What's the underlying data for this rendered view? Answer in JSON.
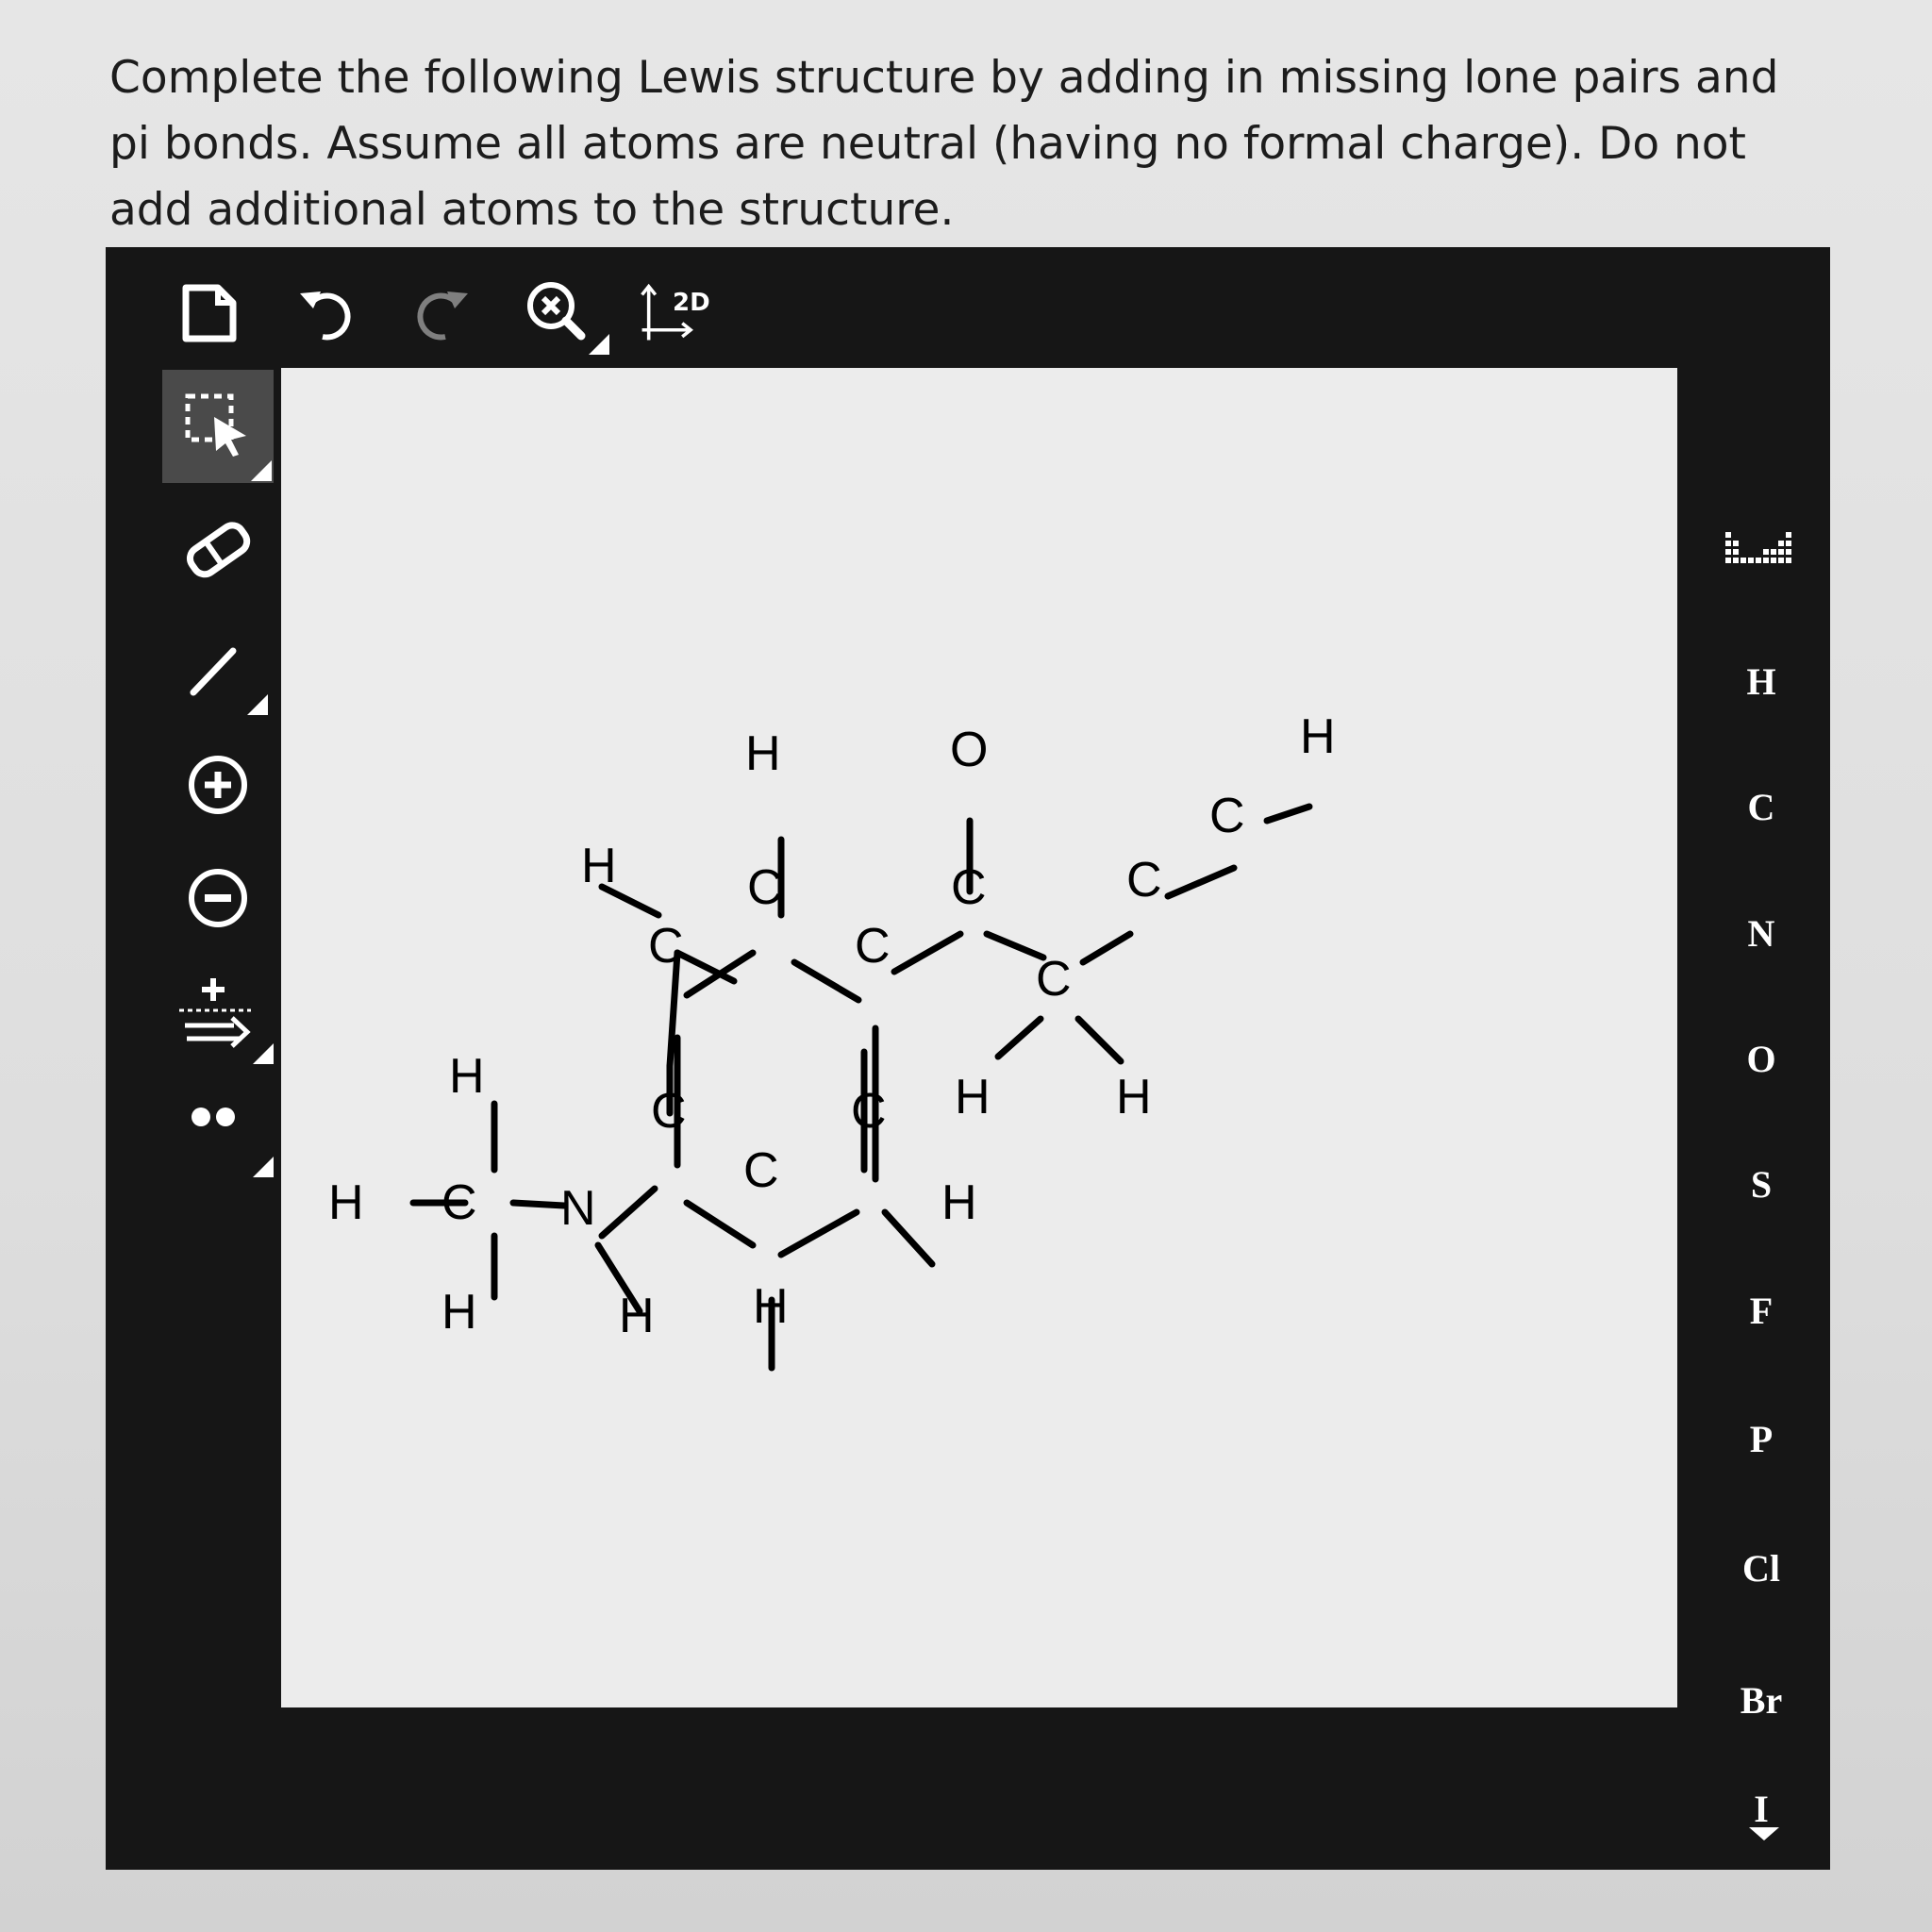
{
  "question": {
    "text": "Complete the following Lewis structure by adding in missing lone pairs and pi bonds. Assume all atoms are neutral (having no formal charge). Do not add additional atoms to the structure."
  },
  "toolbar": {
    "new_icon": "new-document-icon",
    "undo_icon": "undo-icon",
    "redo_icon": "redo-icon",
    "zoom_clear_icon": "zoom-clear-icon",
    "clean2d_label": "2D"
  },
  "left_tools": [
    {
      "name": "select-tool",
      "icon": "selection-arrow-icon",
      "active": true
    },
    {
      "name": "erase-tool",
      "icon": "eraser-icon"
    },
    {
      "name": "bond-tool",
      "icon": "single-bond-icon"
    },
    {
      "name": "charge-plus-tool",
      "icon": "plus-circle-icon",
      "label": "+"
    },
    {
      "name": "charge-minus-tool",
      "icon": "minus-circle-icon",
      "label": "−"
    },
    {
      "name": "arrow-tool",
      "icon": "reaction-arrow-icon",
      "label": "+"
    },
    {
      "name": "lone-pair-tool",
      "icon": "lone-pair-icon"
    }
  ],
  "elements": [
    "H",
    "C",
    "N",
    "O",
    "S",
    "F",
    "P",
    "Cl",
    "Br",
    "I"
  ],
  "molecule": {
    "atoms": [
      {
        "id": "O1",
        "label": "O"
      },
      {
        "id": "H_top_ring",
        "label": "H"
      },
      {
        "id": "H_top_right",
        "label": "H"
      },
      {
        "id": "C_top",
        "label": "C"
      },
      {
        "id": "C_carbonyl",
        "label": "C"
      },
      {
        "id": "H_left",
        "label": "H"
      },
      {
        "id": "C_alkyne2",
        "label": "C"
      },
      {
        "id": "C_alkyne1",
        "label": "C"
      },
      {
        "id": "C_ring_ul",
        "label": "C"
      },
      {
        "id": "C_ring_ur",
        "label": "C"
      },
      {
        "id": "C_ch2",
        "label": "C"
      },
      {
        "id": "H_methyl_top",
        "label": "H"
      },
      {
        "id": "H_ch2_a",
        "label": "H"
      },
      {
        "id": "H_ch2_b",
        "label": "H"
      },
      {
        "id": "C_ring_ll",
        "label": "C"
      },
      {
        "id": "C_ring_lr",
        "label": "C"
      },
      {
        "id": "H_methyl_left",
        "label": "H"
      },
      {
        "id": "C_methyl",
        "label": "C"
      },
      {
        "id": "N1",
        "label": "N"
      },
      {
        "id": "C_ring_bottom",
        "label": "C"
      },
      {
        "id": "H_ring_right",
        "label": "H"
      },
      {
        "id": "H_methyl_bottom",
        "label": "H"
      },
      {
        "id": "H_nh",
        "label": "H"
      },
      {
        "id": "H_ring_bottom",
        "label": "H"
      }
    ]
  }
}
